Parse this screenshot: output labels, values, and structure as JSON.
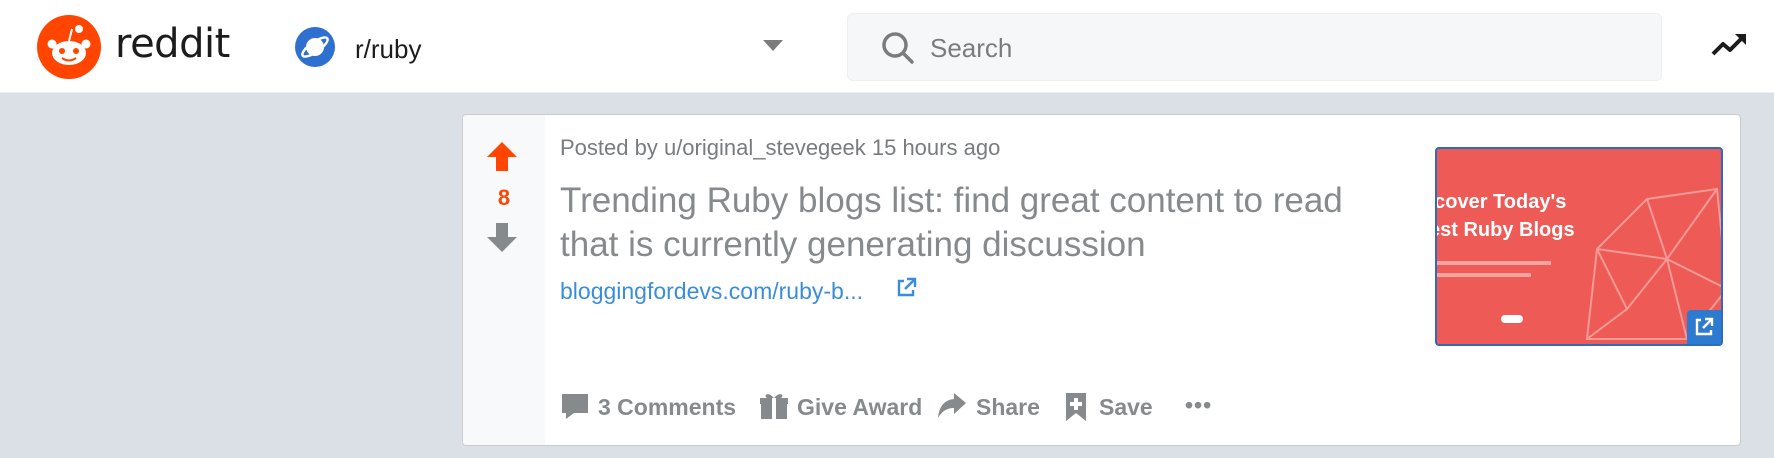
{
  "header": {
    "brand": "reddit",
    "subreddit": "r/ruby",
    "search_placeholder": "Search"
  },
  "post": {
    "score": "8",
    "meta": "Posted by u/original_stevegeek 15 hours ago",
    "title": "Trending Ruby blogs list: find great content to read that is currently generating discussion",
    "link": "bloggingfordevs.com/ruby-b...",
    "thumbnail": {
      "line1": "scover Today's",
      "line2": "est Ruby Blogs"
    },
    "actions": {
      "comments": "3 Comments",
      "award": "Give Award",
      "share": "Share",
      "save": "Save",
      "more": "•••"
    }
  },
  "colors": {
    "brand": "#ff4500",
    "link": "#3a8ddc",
    "thumbnail_bg": "#ee5a56"
  }
}
